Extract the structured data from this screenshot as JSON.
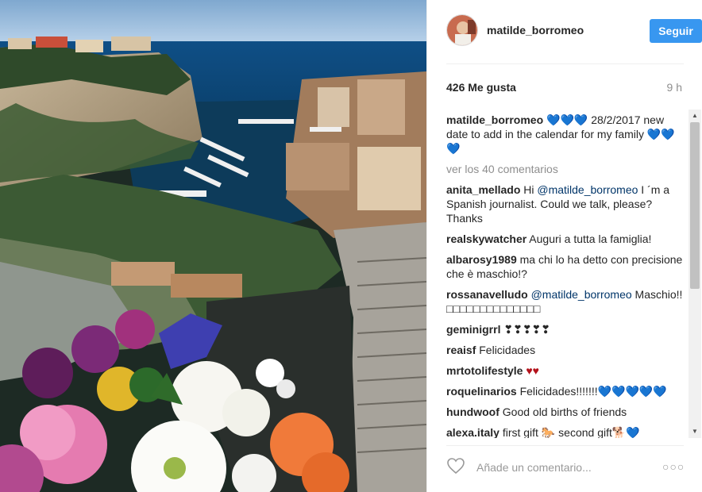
{
  "post": {
    "username": "matilde_borromeo",
    "follow_label": "Seguir",
    "likes": "426 Me gusta",
    "time_ago": "9 h"
  },
  "caption": {
    "user": "matilde_borromeo",
    "hearts": "💙💙💙",
    "text": " 28/2/2017 new date to add in the calendar for my family ",
    "hearts_end": "💙💙💙"
  },
  "load_more": "ver los 40 comentarios",
  "comments": [
    {
      "user": "anita_mellado",
      "pre": " Hi ",
      "mention": "@matilde_borromeo",
      "text": " I ´m a Spanish journalist. Could we talk, please? Thanks",
      "emoji": ""
    },
    {
      "user": "realskywatcher",
      "pre": "",
      "mention": "",
      "text": " Auguri a tutta la famiglia!",
      "emoji": ""
    },
    {
      "user": "albarosy1989",
      "pre": "",
      "mention": "",
      "text": " ma chi lo ha detto con precisione che è maschio!?",
      "emoji": ""
    },
    {
      "user": "rossanavelludo",
      "pre": " ",
      "mention": "@matilde_borromeo",
      "text": " Maschio!! □□□□□□□□□□□□□□",
      "emoji": ""
    },
    {
      "user": "geminigrrl",
      "pre": "",
      "mention": "",
      "text": " ❣❣❣❣❣",
      "emoji": ""
    },
    {
      "user": "reaisf",
      "pre": "",
      "mention": "",
      "text": " Felicidades",
      "emoji": ""
    },
    {
      "user": "mrtotolifestyle",
      "pre": "",
      "mention": "",
      "text": " ",
      "emoji": "♥♥"
    },
    {
      "user": "roquelinarios",
      "pre": "",
      "mention": "",
      "text": " Felicidades!!!!!!!",
      "emoji": "💙💙💙💙💙"
    },
    {
      "user": "hundwoof",
      "pre": "",
      "mention": "",
      "text": " Good old births of friends",
      "emoji": ""
    },
    {
      "user": "alexa.italy",
      "pre": "",
      "mention": "",
      "text": " first gift 🐎 second gift🐕💙",
      "emoji": ""
    }
  ],
  "comment_box": {
    "placeholder": "Añade un comentario..."
  },
  "icons": {
    "like": "heart-outline-icon",
    "more": "more-options-icon"
  },
  "colors": {
    "follow_button": "#3897f0",
    "heart_teal": "#14a9b4",
    "heart_red": "#b3121b"
  }
}
